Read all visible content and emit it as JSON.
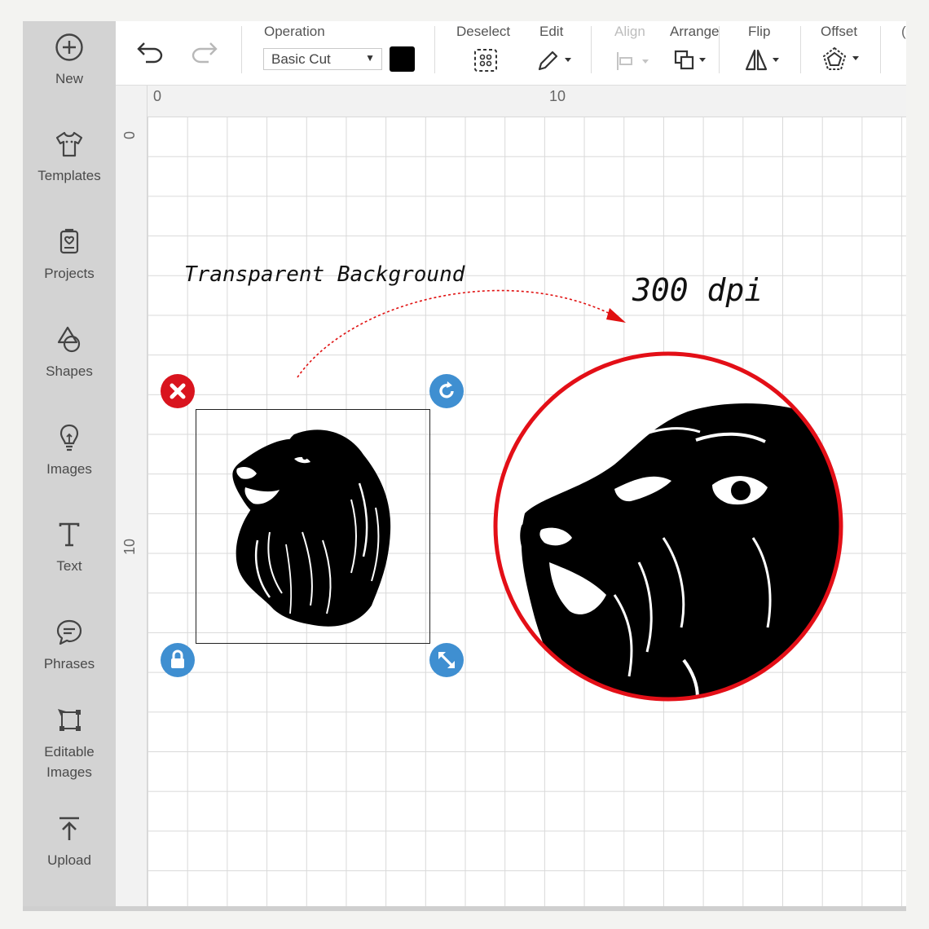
{
  "sidebar": {
    "items": [
      {
        "label": "New",
        "icon": "plus-circle-icon"
      },
      {
        "label": "Templates",
        "icon": "tshirt-icon"
      },
      {
        "label": "Projects",
        "icon": "projects-icon"
      },
      {
        "label": "Shapes",
        "icon": "shapes-icon"
      },
      {
        "label": "Images",
        "icon": "lightbulb-icon"
      },
      {
        "label": "Text",
        "icon": "text-icon"
      },
      {
        "label": "Phrases",
        "icon": "speech-bubble-icon"
      },
      {
        "label": "Editable Images",
        "label_line1": "Editable",
        "label_line2": "Images",
        "icon": "editable-images-icon"
      },
      {
        "label": "Upload",
        "icon": "upload-icon"
      }
    ]
  },
  "toolbar": {
    "operation_label": "Operation",
    "operation_value": "Basic Cut",
    "swatch_color": "#000000",
    "deselect_label": "Deselect",
    "edit_label": "Edit",
    "align_label": "Align",
    "arrange_label": "Arrange",
    "flip_label": "Flip",
    "offset_label": "Offset"
  },
  "rulers": {
    "top": [
      "0",
      "10"
    ],
    "left": [
      "0",
      "10"
    ]
  },
  "annotations": {
    "transparent": "Transparent Background",
    "dpi": "300 dpi"
  },
  "colors": {
    "delete_handle": "#d9141e",
    "blue_handle": "#3f8fd1",
    "zoom_ring": "#e30f17",
    "sidebar_bg": "#d3d3d3"
  }
}
